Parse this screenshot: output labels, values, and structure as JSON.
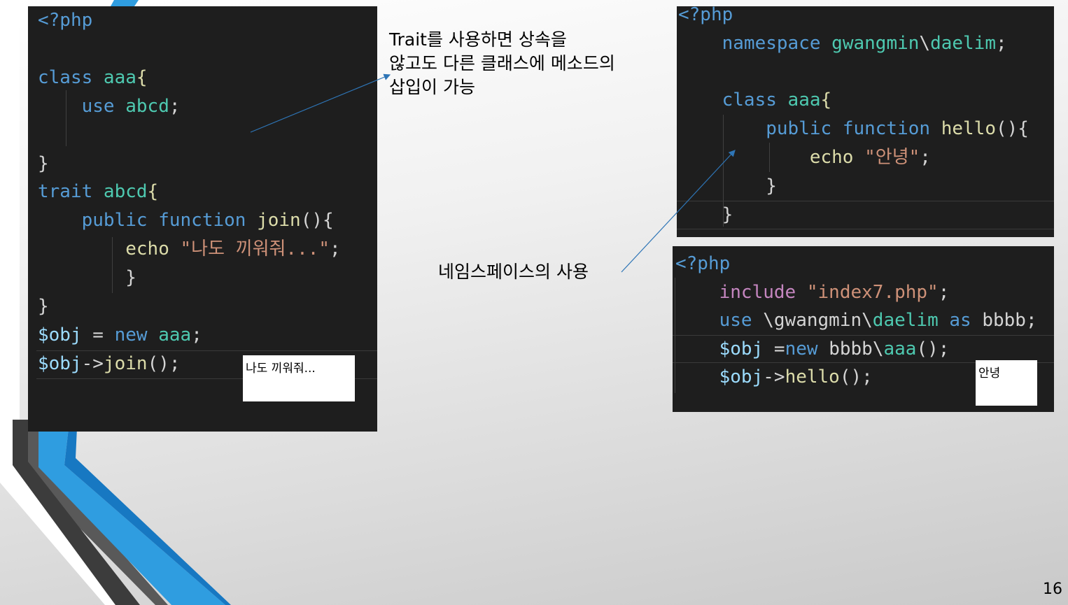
{
  "left_code": {
    "lines": [
      [
        {
          "t": "<?php",
          "c": "kw"
        }
      ],
      [],
      [
        {
          "t": "class ",
          "c": "kw"
        },
        {
          "t": "aaa",
          "c": "ty"
        },
        {
          "t": "{",
          "c": "fn"
        }
      ],
      [
        {
          "t": "    "
        },
        {
          "t": "use ",
          "c": "kw"
        },
        {
          "t": "abcd",
          "c": "ty"
        },
        {
          "t": ";"
        }
      ],
      [],
      [
        {
          "t": "}"
        }
      ],
      [
        {
          "t": "trait ",
          "c": "kw"
        },
        {
          "t": "abcd",
          "c": "ty"
        },
        {
          "t": "{",
          "c": "fn"
        }
      ],
      [
        {
          "t": "    "
        },
        {
          "t": "public ",
          "c": "kw"
        },
        {
          "t": "function ",
          "c": "kw"
        },
        {
          "t": "join",
          "c": "fn"
        },
        {
          "t": "(){"
        }
      ],
      [
        {
          "t": "        "
        },
        {
          "t": "echo ",
          "c": "fn"
        },
        {
          "t": "\"나도 끼워줘...\"",
          "c": "st"
        },
        {
          "t": ";"
        }
      ],
      [
        {
          "t": "        "
        },
        {
          "t": "}"
        }
      ],
      [
        {
          "t": "}"
        }
      ],
      [
        {
          "t": "$obj",
          "c": "vr"
        },
        {
          "t": " = "
        },
        {
          "t": "new ",
          "c": "kw"
        },
        {
          "t": "aaa",
          "c": "ty"
        },
        {
          "t": ";"
        }
      ],
      [
        {
          "t": "$obj",
          "c": "vr"
        },
        {
          "t": "->"
        },
        {
          "t": "join",
          "c": "fn"
        },
        {
          "t": "();"
        }
      ]
    ]
  },
  "left_output": "나도 끼워줘...",
  "trait_note": "Trait를 사용하면 상속을\n않고도 다른 클래스에 메소드의\n삽입이 가능",
  "namespace_note": "네임스페이스의 사용",
  "right_top_code": {
    "lines": [
      [
        {
          "t": "<?php",
          "c": "kw"
        }
      ],
      [
        {
          "t": "    "
        },
        {
          "t": "namespace ",
          "c": "kw"
        },
        {
          "t": "gwangmin",
          "c": "ty"
        },
        {
          "t": "\\"
        },
        {
          "t": "daelim",
          "c": "ty"
        },
        {
          "t": ";"
        }
      ],
      [],
      [
        {
          "t": "    "
        },
        {
          "t": "class ",
          "c": "kw"
        },
        {
          "t": "aaa",
          "c": "ty"
        },
        {
          "t": "{",
          "c": "fn"
        }
      ],
      [
        {
          "t": "        "
        },
        {
          "t": "public ",
          "c": "kw"
        },
        {
          "t": "function ",
          "c": "kw"
        },
        {
          "t": "hello",
          "c": "fn"
        },
        {
          "t": "(){"
        }
      ],
      [
        {
          "t": "            "
        },
        {
          "t": "echo ",
          "c": "fn"
        },
        {
          "t": "\"안녕\"",
          "c": "st"
        },
        {
          "t": ";"
        }
      ],
      [
        {
          "t": "        "
        },
        {
          "t": "}"
        }
      ],
      [
        {
          "t": "    "
        },
        {
          "t": "}"
        }
      ]
    ]
  },
  "right_bottom_code": {
    "lines": [
      [
        {
          "t": "<?php",
          "c": "kw"
        }
      ],
      [
        {
          "t": "    "
        },
        {
          "t": "include ",
          "c": "kw2"
        },
        {
          "t": "\"index7.php\"",
          "c": "st"
        },
        {
          "t": ";"
        }
      ],
      [
        {
          "t": "    "
        },
        {
          "t": "use ",
          "c": "kw"
        },
        {
          "t": "\\gwangmin\\"
        },
        {
          "t": "daelim",
          "c": "ty"
        },
        {
          "t": " as ",
          "c": "kw"
        },
        {
          "t": "bbbb"
        },
        {
          "t": ";"
        }
      ],
      [
        {
          "t": "    "
        },
        {
          "t": "$obj",
          "c": "vr"
        },
        {
          "t": " ="
        },
        {
          "t": "new ",
          "c": "kw"
        },
        {
          "t": "bbbb"
        },
        {
          "t": "\\"
        },
        {
          "t": "aaa",
          "c": "ty"
        },
        {
          "t": "();"
        }
      ],
      [
        {
          "t": "    "
        },
        {
          "t": "$obj",
          "c": "vr"
        },
        {
          "t": "->"
        },
        {
          "t": "hello",
          "c": "fn"
        },
        {
          "t": "();"
        }
      ]
    ]
  },
  "right_output": "안녕",
  "page_number": "16",
  "colors": {
    "code_bg": "#1e1e1e",
    "keyword": "#569cd6",
    "type": "#4ec9b0",
    "function": "#dcdcaa",
    "string": "#ce9178",
    "variable": "#9cdcfe",
    "control": "#c586c0",
    "arrow": "#2e75b6"
  }
}
